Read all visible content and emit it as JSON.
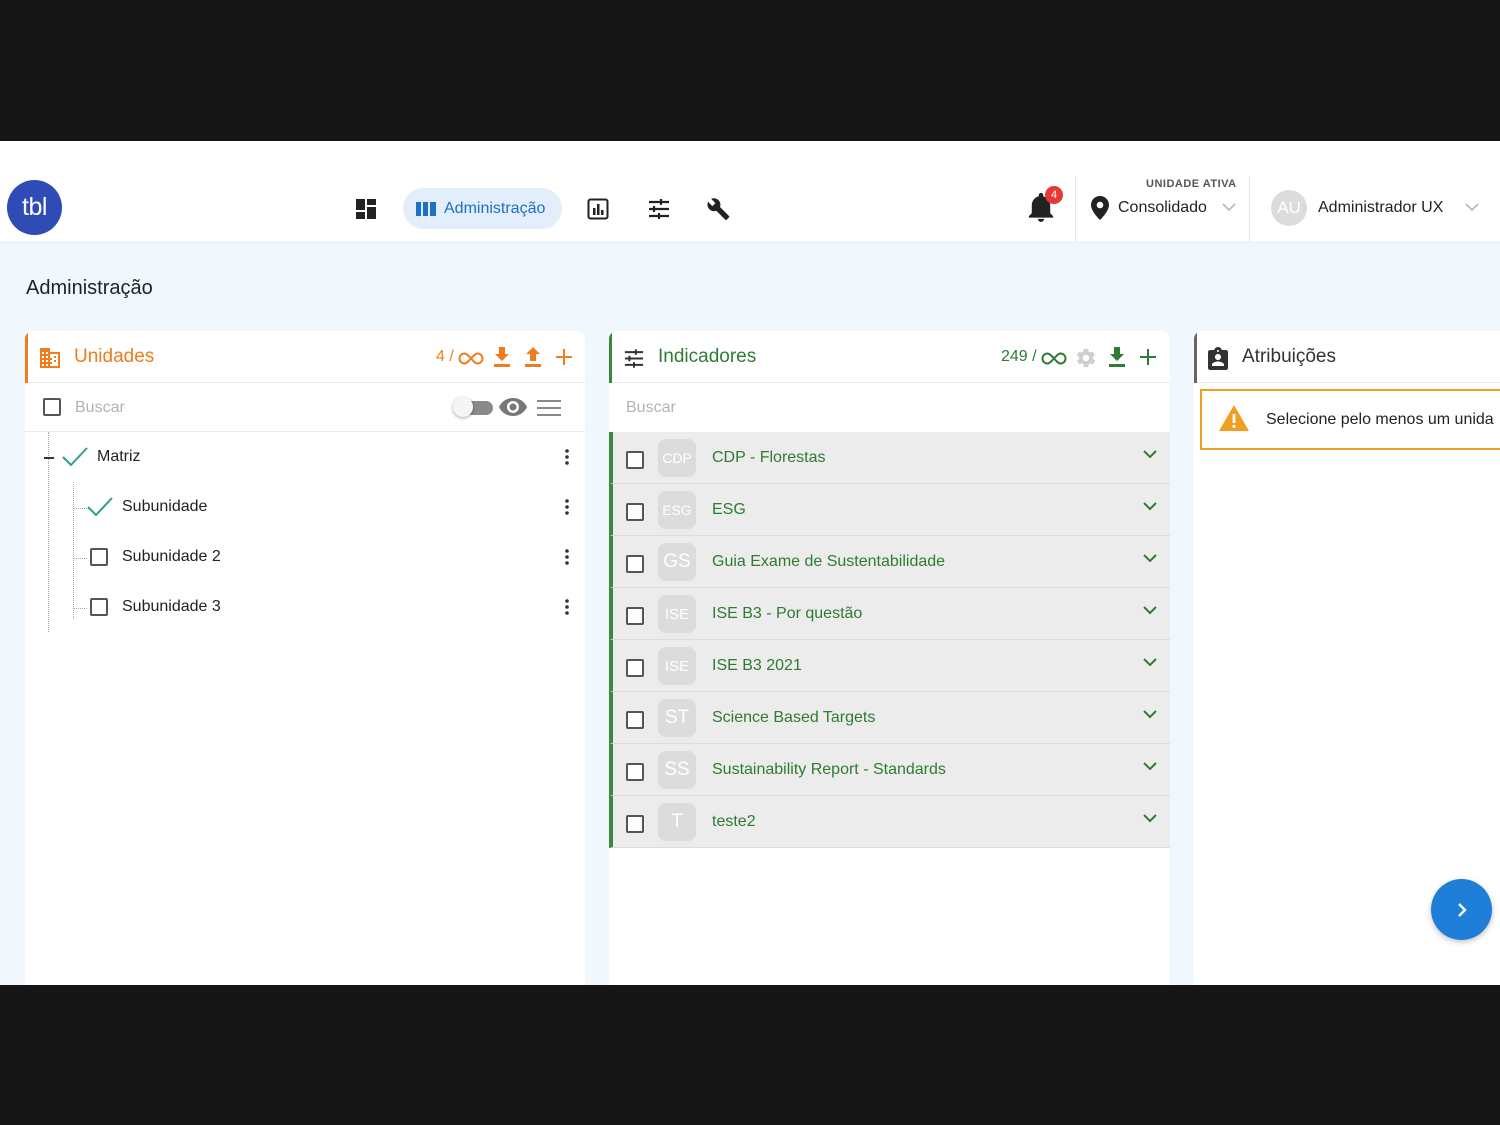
{
  "app": {
    "logo_text": "tbl"
  },
  "nav": {
    "items": [
      {
        "name": "dashboard",
        "icon": "dashboard-icon"
      },
      {
        "name": "admin",
        "label": "Administração",
        "icon": "columns-icon",
        "active": true
      },
      {
        "name": "reports",
        "icon": "chart-icon"
      },
      {
        "name": "filters",
        "icon": "sliders-icon"
      },
      {
        "name": "tools",
        "icon": "wrench-icon"
      }
    ]
  },
  "notifications": {
    "count": "4"
  },
  "active_unit": {
    "label": "UNIDADE ATIVA",
    "value": "Consolidado"
  },
  "user": {
    "initials": "AU",
    "name": "Administrador UX"
  },
  "page": {
    "title": "Administração"
  },
  "unidades": {
    "title": "Unidades",
    "count_prefix": "4 /",
    "search_placeholder": "Buscar",
    "tree": [
      {
        "label": "Matriz",
        "level": 0,
        "state": "checked"
      },
      {
        "label": "Subunidade",
        "level": 1,
        "state": "checked"
      },
      {
        "label": "Subunidade 2",
        "level": 1,
        "state": "unchecked"
      },
      {
        "label": "Subunidade 3",
        "level": 1,
        "state": "unchecked"
      }
    ]
  },
  "indicadores": {
    "title": "Indicadores",
    "count_prefix": "249 /",
    "search_placeholder": "Buscar",
    "items": [
      {
        "abbr": "CDP",
        "name": "CDP - Florestas"
      },
      {
        "abbr": "ESG",
        "name": "ESG"
      },
      {
        "abbr": "GS",
        "name": "Guia Exame de Sustentabilidade"
      },
      {
        "abbr": "ISE",
        "name": "ISE B3 - Por questão"
      },
      {
        "abbr": "ISE",
        "name": "ISE B3 2021"
      },
      {
        "abbr": "ST",
        "name": "Science Based Targets"
      },
      {
        "abbr": "SS",
        "name": "Sustainability Report - Standards"
      },
      {
        "abbr": "T",
        "name": "teste2"
      }
    ]
  },
  "atribuicoes": {
    "title": "Atribuições",
    "warning": "Selecione pelo menos um unida"
  },
  "colors": {
    "orange": "#ee7d1d",
    "green": "#2f7b32",
    "blue": "#1e6fc6"
  }
}
